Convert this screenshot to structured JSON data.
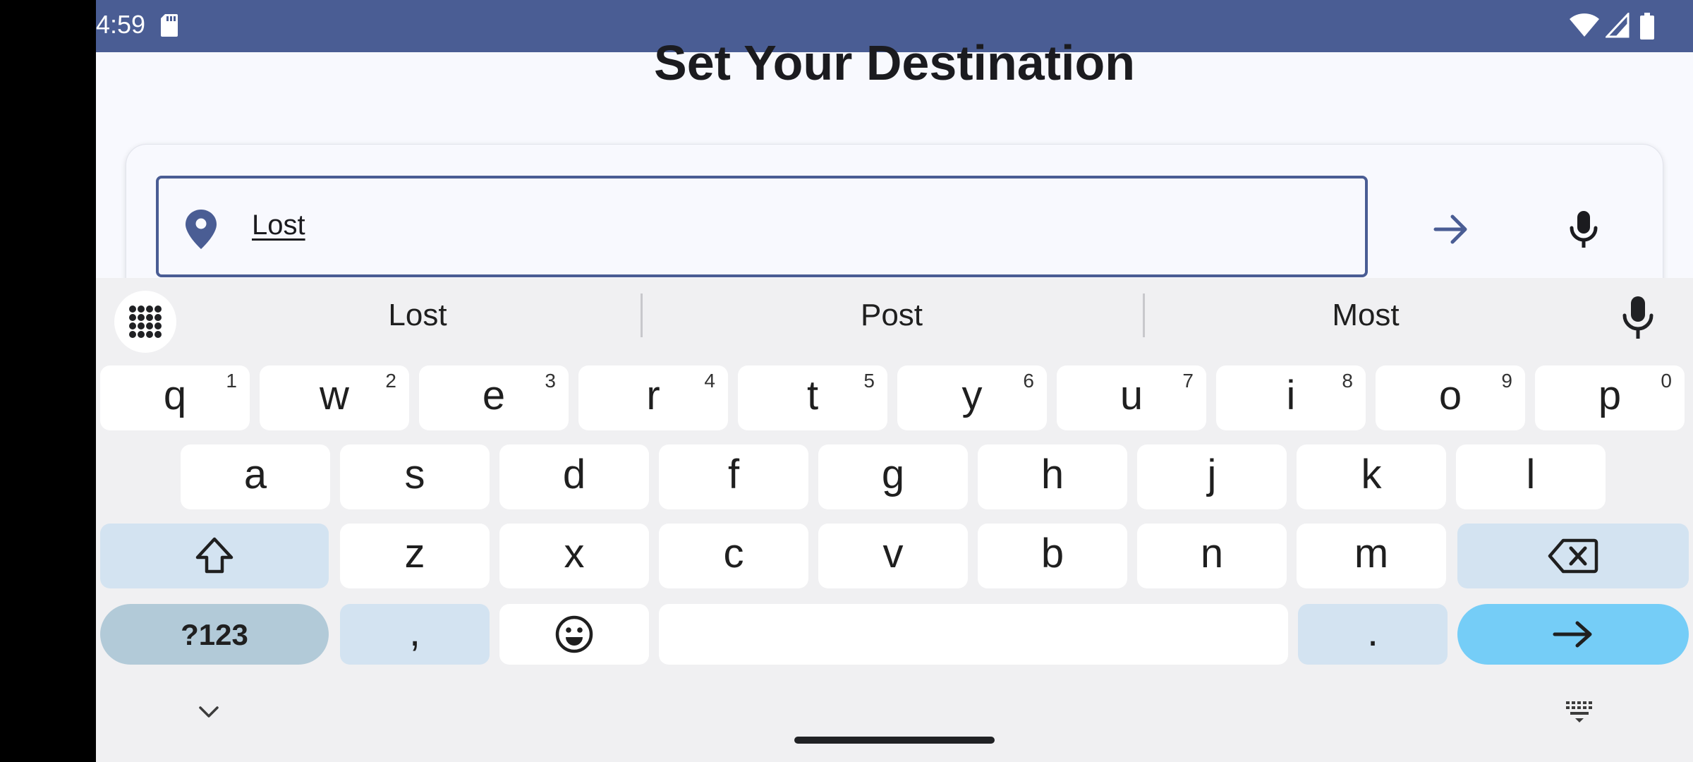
{
  "status_bar": {
    "time": "4:59",
    "background": "#4a5d94"
  },
  "page": {
    "title": "Set Your Destination"
  },
  "destination": {
    "value": "Lost",
    "pin_icon": "location-pin-icon",
    "go_icon": "arrow-right-icon",
    "mic_icon": "microphone-icon",
    "accent": "#4a5d94"
  },
  "keyboard": {
    "suggestions": [
      "Lost",
      "Post",
      "Most"
    ],
    "row1": [
      {
        "k": "q",
        "n": "1"
      },
      {
        "k": "w",
        "n": "2"
      },
      {
        "k": "e",
        "n": "3"
      },
      {
        "k": "r",
        "n": "4"
      },
      {
        "k": "t",
        "n": "5"
      },
      {
        "k": "y",
        "n": "6"
      },
      {
        "k": "u",
        "n": "7"
      },
      {
        "k": "i",
        "n": "8"
      },
      {
        "k": "o",
        "n": "9"
      },
      {
        "k": "p",
        "n": "0"
      }
    ],
    "row2": [
      "a",
      "s",
      "d",
      "f",
      "g",
      "h",
      "j",
      "k",
      "l"
    ],
    "row3": [
      "z",
      "x",
      "c",
      "v",
      "b",
      "n",
      "m"
    ],
    "symbols_label": "?123",
    "comma_label": ",",
    "period_label": ".",
    "enter_color": "#75cdf7",
    "modifier_color": "#d3e3f1"
  }
}
